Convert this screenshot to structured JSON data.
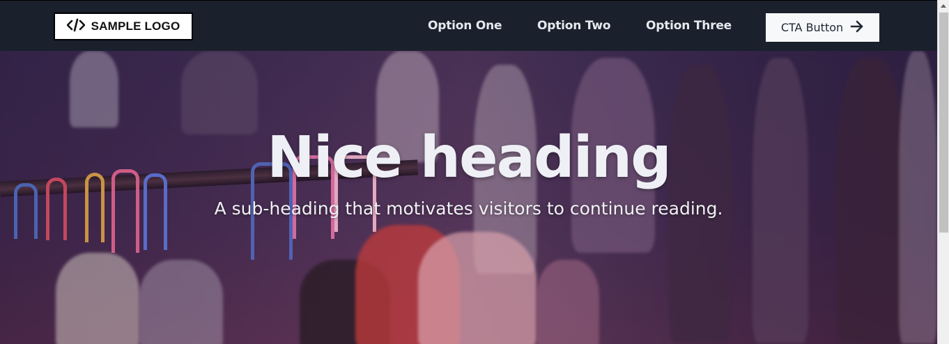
{
  "nav": {
    "logo_text": "SAMPLE LOGO",
    "links": [
      {
        "label": "Option One"
      },
      {
        "label": "Option Two"
      },
      {
        "label": "Option Three"
      }
    ],
    "cta_label": "CTA Button"
  },
  "hero": {
    "heading": "Nice heading",
    "subheading": "A sub-heading that motivates visitors to continue reading."
  },
  "icons": {
    "logo_icon": "code-icon",
    "cta_icon": "arrow-right-icon"
  },
  "colors": {
    "nav_bg": "#1a202c",
    "cta_bg": "#f7f8fa",
    "heading": "#eef0f5"
  }
}
